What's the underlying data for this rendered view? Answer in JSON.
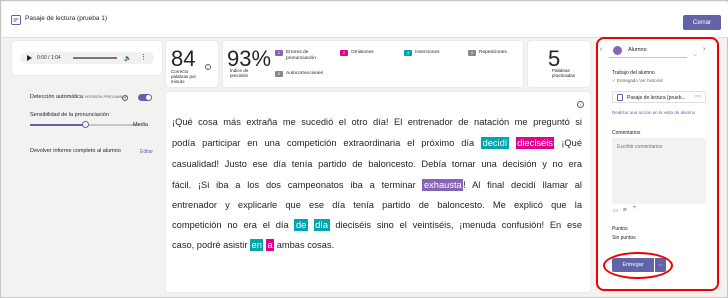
{
  "window": {
    "title": "Pasaje de lectura (prueba 1)",
    "close_label": "Cerrar",
    "accent": "#6264a7"
  },
  "audio": {
    "time": "0:00 / 1:04",
    "icons": [
      "play-icon",
      "volume-icon",
      "more-icon"
    ]
  },
  "settings": {
    "auto_detect_label": "Detección automática",
    "preview_tag": "VERSIÓN PRELIMINAR",
    "auto_detect_on": true,
    "sensitivity_label": "Sensibilidad de la pronunciación",
    "sensitivity_value": "Media",
    "sensitivity_level": 0.5,
    "return_label": "Devolver informe completo al alumno",
    "edit_label": "Editar"
  },
  "stats": {
    "wcpm_value": "84",
    "wcpm_label": "Correcto palabras por minuto",
    "accuracy_value": "93%",
    "accuracy_label": "Índice de precisión",
    "categories": [
      {
        "count": "1",
        "label": "Errores de pronunciación",
        "color": "#8764b8"
      },
      {
        "count": "0",
        "label": "Autocorrecciones",
        "color": "#8a8886"
      },
      {
        "count": "2",
        "label": "Omisiones",
        "color": "#e3008c"
      },
      {
        "count": "4",
        "label": "Inserciones",
        "color": "#00a5af"
      },
      {
        "count": "0",
        "label": "Repeticiones",
        "color": "#8a8886"
      }
    ],
    "practiced_value": "5",
    "practiced_label": "Palabras practicadas"
  },
  "passage": {
    "colors": {
      "insertion": "#00a5af",
      "omission": "#e3008c",
      "mispronunciation": "#8764b8"
    },
    "lines": [
      [
        {
          "t": "¡Qué cosa más extraña me sucedió el otro día! El entrenador de natación me preguntó si"
        }
      ],
      [
        {
          "t": "podía participar en una competición extraordinaria el próximo día "
        },
        {
          "t": "decidí",
          "k": "insertion"
        },
        {
          "t": " "
        },
        {
          "t": "dieciséis",
          "k": "omission"
        },
        {
          "t": " ¡Qué"
        }
      ],
      [
        {
          "t": "casualidad! Justo ese día tenía partido de baloncesto. Debía tomar una decisión y no era"
        }
      ],
      [
        {
          "t": "fácil. ¡Si iba a los dos campeonatos iba a terminar "
        },
        {
          "t": "exhausta",
          "k": "mispronunciation"
        },
        {
          "t": "! Al final decidí llamar al"
        }
      ],
      [
        {
          "t": "entrenador y explicarle que ese día tenía partido de baloncesto. Me explicó que la"
        }
      ],
      [
        {
          "t": "competición no era el día "
        },
        {
          "t": "de",
          "k": "insertion"
        },
        {
          "t": " "
        },
        {
          "t": "día",
          "k": "insertion"
        },
        {
          "t": " dieciséis sino el veintiséis, ¡menuda confusión! En ese"
        }
      ],
      [
        {
          "t": "caso, podré asistir "
        },
        {
          "t": "en",
          "k": "insertion"
        },
        {
          "t": " "
        },
        {
          "t": "a",
          "k": "omission"
        },
        {
          "t": " ambas cosas."
        }
      ]
    ]
  },
  "review": {
    "student_label": "Alumno",
    "work_label": "Trabajo del alumno",
    "submitted_label": "✓ Entregado",
    "history_link": "Ver historial",
    "file_name": "Pasaje de lectura (prueb...",
    "action_link": "Realizar una acción en la vista de alumno",
    "comments_label": "Comentarios",
    "comments_placeholder": "Escribir comentarios",
    "points_label": "Puntos",
    "points_value": "Sin puntos",
    "submit_label": "Entregar"
  },
  "annotation_color": "#e00000"
}
